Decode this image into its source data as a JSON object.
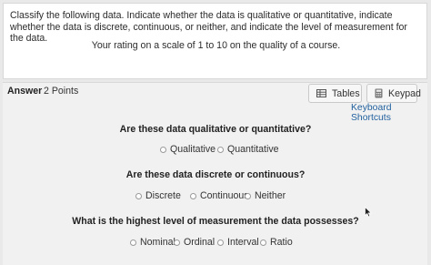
{
  "question": {
    "prompt": "Classify the following data. Indicate whether the data is qualitative or quantitative, indicate whether the data is discrete, continuous, or neither, and indicate the level of measurement for the data.",
    "scenario": "Your rating on a scale of 1 to 10 on the quality of a course."
  },
  "answer": {
    "label": "Answer",
    "points": "2 Points"
  },
  "tools": {
    "tables_label": "Tables",
    "keypad_label": "Keypad",
    "shortcuts_label": "Keyboard Shortcuts"
  },
  "q1": {
    "title": "Are these data qualitative or quantitative?",
    "options": [
      "Qualitative",
      "Quantitative"
    ]
  },
  "q2": {
    "title": "Are these data discrete or continuous?",
    "options": [
      "Discrete",
      "Continuous",
      "Neither"
    ]
  },
  "q3": {
    "title": "What is the highest level of measurement the data possesses?",
    "options": [
      "Nominal",
      "Ordinal",
      "Interval",
      "Ratio"
    ]
  },
  "icons": {
    "tables": "table-icon",
    "keypad": "calculator-icon",
    "cursor": "mouse-pointer-icon"
  },
  "colors": {
    "link": "#1f5f9e",
    "background": "#e9e9e9"
  }
}
